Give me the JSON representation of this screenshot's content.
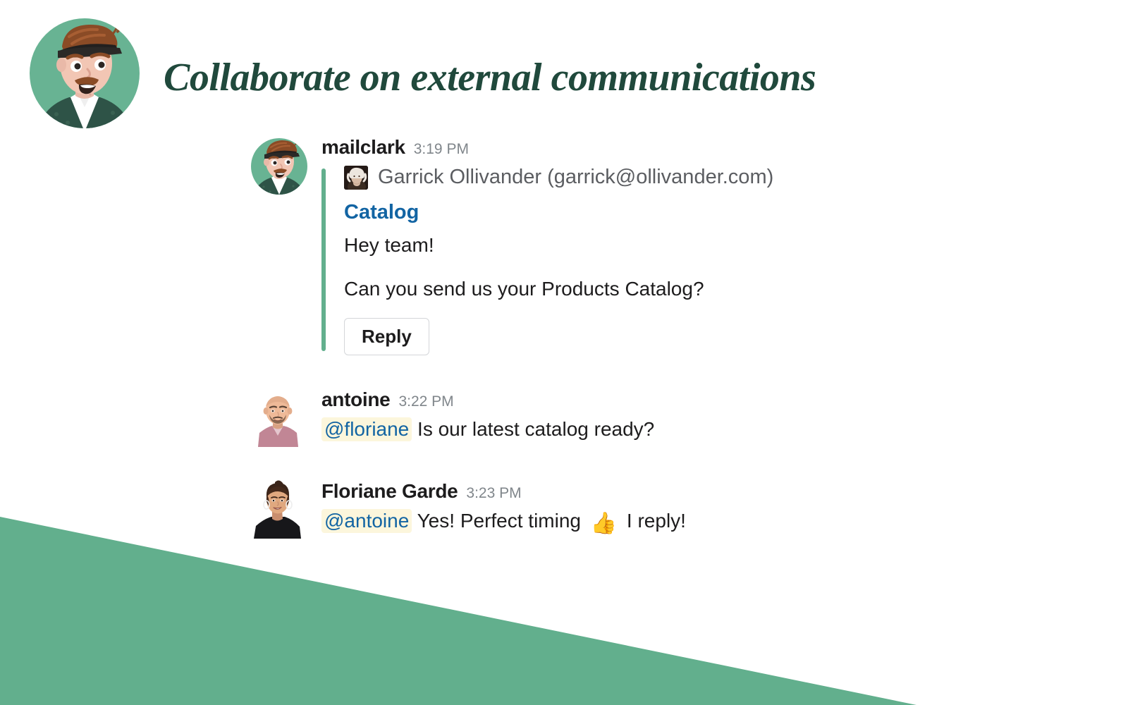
{
  "page": {
    "title": "Collaborate on external communications",
    "title_color": "#20493C",
    "accent_green": "#62AF8D",
    "link_blue": "#1264A3",
    "mention_bg": "#FCF6DC",
    "background": "#ffffff"
  },
  "brand": {
    "avatar_name": "mailclark-mascot-avatar"
  },
  "messages": [
    {
      "id": "mailclark",
      "author": "mailclark",
      "time": "3:19 PM",
      "avatar_name": "mailclark-avatar",
      "attachment": {
        "from": "Garrick Ollivander (garrick@ollivander.com)",
        "thumb_name": "garrick-ollivander-photo",
        "subject": "Catalog",
        "lines": [
          "Hey team!",
          "Can you send us your Products Catalog?"
        ],
        "reply_label": "Reply"
      }
    },
    {
      "id": "antoine",
      "author": "antoine",
      "time": "3:22 PM",
      "avatar_name": "antoine-avatar",
      "mention": "@floriane",
      "text": "Is our latest catalog ready?"
    },
    {
      "id": "floriane",
      "author": "Floriane Garde",
      "time": "3:23 PM",
      "avatar_name": "floriane-garde-avatar",
      "mention": "@antoine",
      "text_before_emoji": "Yes! Perfect timing",
      "emoji": "👍",
      "emoji_name": "thumbs-up-emoji",
      "text_after_emoji": "I reply!"
    }
  ]
}
